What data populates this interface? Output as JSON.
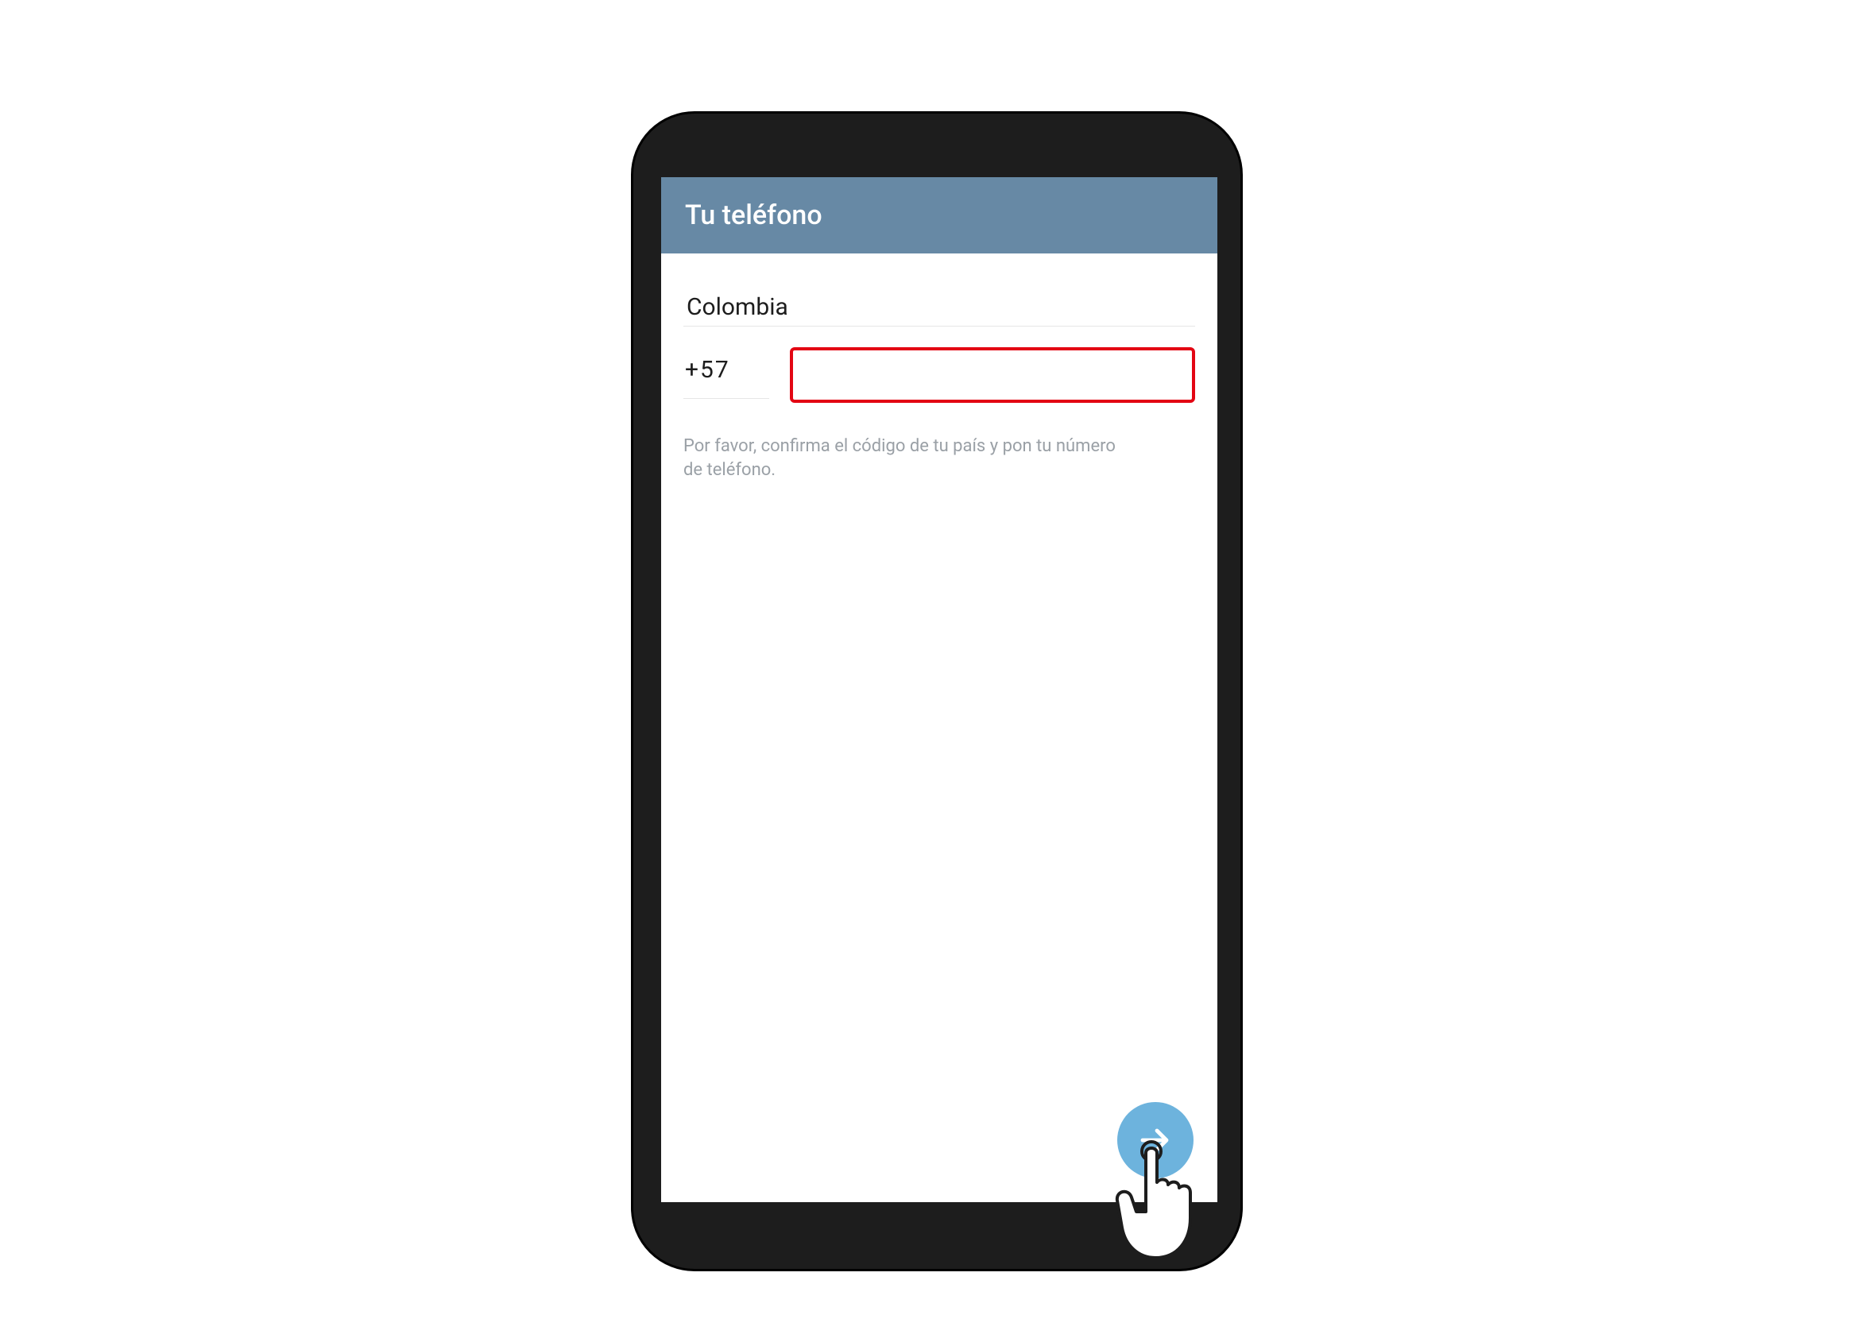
{
  "header": {
    "title": "Tu teléfono"
  },
  "form": {
    "country": "Colombia",
    "country_code": "+57",
    "phone_value": "",
    "helper_text": "Por favor, confirma el código de tu país y pon tu número de teléfono."
  },
  "fab_icon": "arrow-right"
}
